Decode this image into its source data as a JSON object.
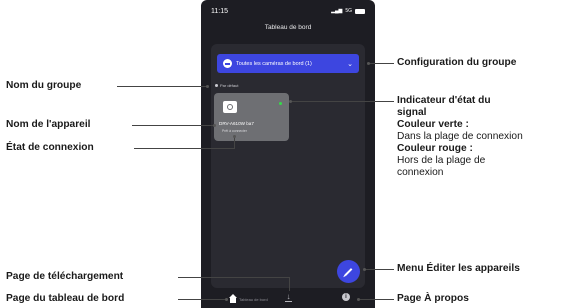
{
  "phone": {
    "status_time": "11:15",
    "status_network": "5G",
    "header_title": "Tableau de bord",
    "group_selector": "Toutes les caméras de bord (1)",
    "default_group": "Par défaut",
    "device_name": "DRV-A610W ba7",
    "device_status": "Prêt à connecter",
    "nav_home_label": "Tableau de bord"
  },
  "callouts": {
    "group_config": "Configuration du groupe",
    "group_name": "Nom du groupe",
    "device_name": "Nom de l'appareil",
    "connection_state": "État de connexion",
    "signal_title_1": "Indicateur d'état du",
    "signal_title_2": "signal",
    "green_heading": "Couleur verte :",
    "green_text": "Dans la plage de connexion",
    "red_heading": "Couleur rouge :",
    "red_text_1": "Hors de la plage de",
    "red_text_2": "connexion",
    "download_page": "Page de téléchargement",
    "dashboard_page": "Page du tableau de bord",
    "edit_devices": "Menu Éditer les appareils",
    "about_page": "Page À propos"
  },
  "colors": {
    "accent": "#3d46e0",
    "signal_green": "#35d94a",
    "phone_bg": "#1d1d23"
  },
  "icons": [
    "camera-icon",
    "chevron-down-icon",
    "pencil-icon",
    "home-icon",
    "download-icon",
    "info-icon"
  ]
}
